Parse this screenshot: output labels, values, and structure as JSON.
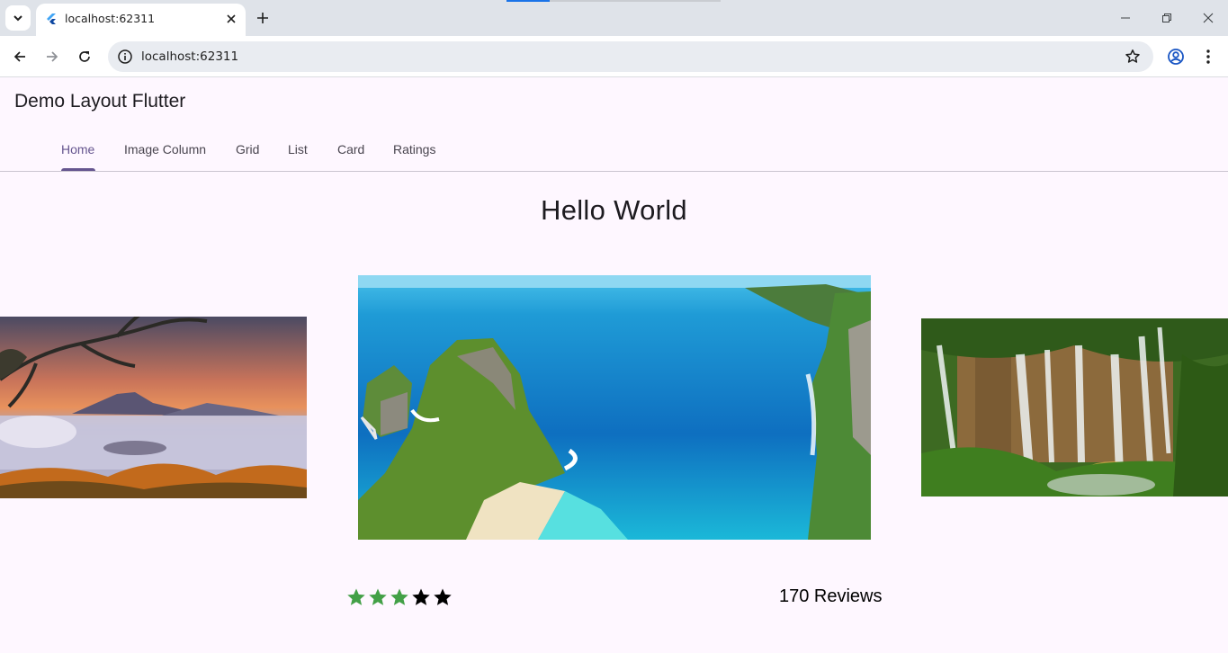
{
  "browser": {
    "tab_title": "localhost:62311",
    "url": "localhost:62311"
  },
  "app": {
    "title": "Demo Layout Flutter",
    "tabs": [
      {
        "label": "Home",
        "active": true
      },
      {
        "label": "Image Column",
        "active": false
      },
      {
        "label": "Grid",
        "active": false
      },
      {
        "label": "List",
        "active": false
      },
      {
        "label": "Card",
        "active": false
      },
      {
        "label": "Ratings",
        "active": false
      }
    ],
    "accent_color": "#65558f"
  },
  "main": {
    "heading": "Hello World",
    "carousel": {
      "images": [
        {
          "name": "volcano-sunrise-image"
        },
        {
          "name": "coastal-cliff-beach-image"
        },
        {
          "name": "waterfall-forest-image"
        }
      ]
    },
    "rating": {
      "stars_total": 5,
      "stars_filled": 3,
      "filled_color": "#43a047",
      "empty_color": "#000000",
      "reviews_label": "170 Reviews"
    }
  }
}
